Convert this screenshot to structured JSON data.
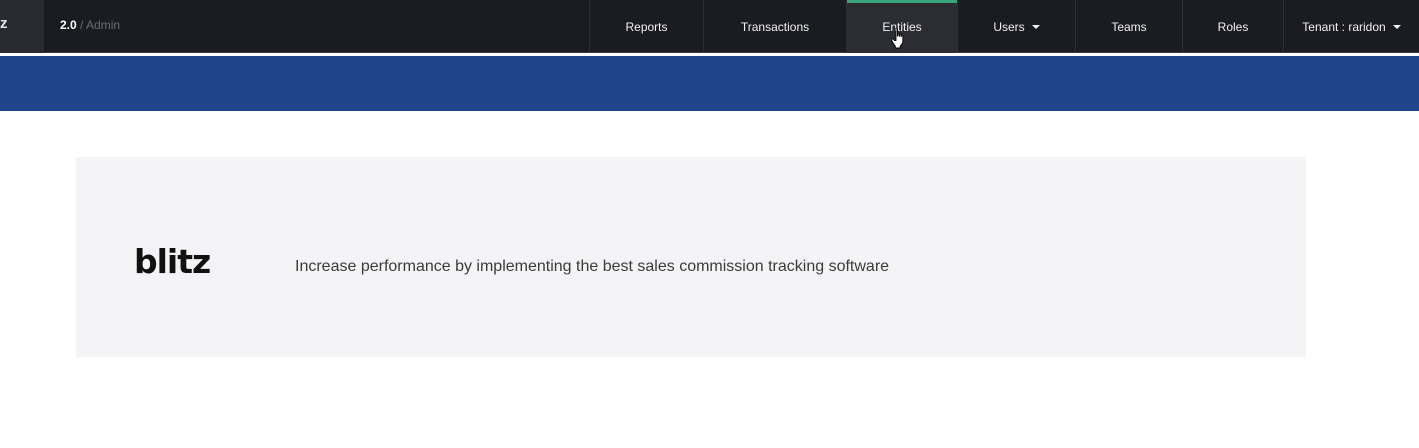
{
  "brand": {
    "mark": "z",
    "version": "2.0",
    "separator": " / ",
    "section": "Admin"
  },
  "nav": {
    "reports": "Reports",
    "transactions": "Transactions",
    "entities": "Entities",
    "users": "Users",
    "teams": "Teams",
    "roles": "Roles",
    "tenant": "Tenant : raridon"
  },
  "active_nav": "Entities",
  "hero": {
    "logo": "blitz",
    "tagline": "Increase performance by implementing the best sales commission tracking software"
  },
  "colors": {
    "topbar": "#1b1c21",
    "band": "#1e4489",
    "active_accent": "#3aa57a",
    "hero_bg": "#f4f4f6"
  }
}
